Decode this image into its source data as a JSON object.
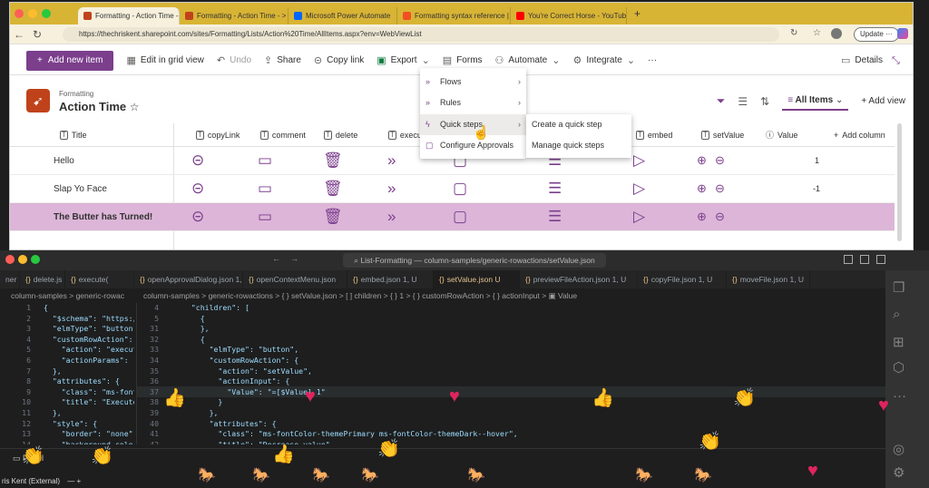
{
  "browser": {
    "tabs": [
      {
        "label": "Formatting - Action Time - All It",
        "color": "#c0421b",
        "active": true
      },
      {
        "label": "Formatting - Action Time - >",
        "color": "#c0421b"
      },
      {
        "label": "Microsoft Power Automate",
        "color": "#0066ff"
      },
      {
        "label": "Formatting syntax reference | N",
        "color": "#f25022"
      },
      {
        "label": "You're Correct Horse - YouTube",
        "color": "#ff0000"
      }
    ],
    "new_tab": "+",
    "url": "https://thechriskent.sharepoint.com/sites/Formatting/Lists/Action%20Time/AllItems.aspx?env=WebViewList",
    "update_label": "Update"
  },
  "commandbar": {
    "new_item": "Add new item",
    "grid_edit": "Edit in grid view",
    "undo": "Undo",
    "share": "Share",
    "copy_link": "Copy link",
    "export": "Export",
    "forms": "Forms",
    "automate": "Automate",
    "integrate": "Integrate",
    "more": "···",
    "details": "Details"
  },
  "list": {
    "site": "Formatting",
    "title": "Action Time",
    "view": "All Items",
    "add_view": "Add view",
    "columns": [
      "Title",
      "copyLink",
      "comment",
      "delete",
      "execut",
      "embed",
      "setValue",
      "Value",
      "Add column"
    ],
    "rows": [
      {
        "title": "Hello",
        "value": "1"
      },
      {
        "title": "Slap Yo Face",
        "value": "-1"
      },
      {
        "title": "The Butter has Turned!",
        "value": ""
      }
    ]
  },
  "automate_menu": {
    "items": [
      "Flows",
      "Rules",
      "Quick steps",
      "Configure Approvals"
    ],
    "submenu": [
      "Create a quick step",
      "Manage quick steps"
    ]
  },
  "vscode": {
    "title": "List-Formatting — column-samples/generic-rowactions/setValue.json",
    "tabs": [
      {
        "label": "ner"
      },
      {
        "label": "delete.js"
      },
      {
        "label": "execute("
      },
      {
        "label": "openApprovalDialog.json 1,"
      },
      {
        "label": "openContextMenu.json"
      },
      {
        "label": "embed.json 1, U"
      },
      {
        "label": "setValue.json U",
        "active": true
      },
      {
        "label": "previewFileAction.json 1, U"
      },
      {
        "label": "copyFile.json 1, U"
      },
      {
        "label": "moveFile.json 1, U"
      }
    ],
    "breadcrumb_left": "column-samples > generic-rowac",
    "breadcrumb_right": "column-samples > generic-rowactions > { } setValue.json > [ ] children > { } 1 > { } customRowAction > { } actionInput > ▣ Value",
    "left_code": [
      {
        "n": "1",
        "t": "{"
      },
      {
        "n": "2",
        "t": "  \"$schema\": \"https:/"
      },
      {
        "n": "3",
        "t": "  \"elmType\": \"button\""
      },
      {
        "n": "4",
        "t": "  \"customRowAction\": {"
      },
      {
        "n": "5",
        "t": "    \"action\": \"execut"
      },
      {
        "n": "6",
        "t": "    \"actionParams\": \""
      },
      {
        "n": "7",
        "t": "  },"
      },
      {
        "n": "8",
        "t": "  \"attributes\": {"
      },
      {
        "n": "9",
        "t": "    \"class\": \"ms-font"
      },
      {
        "n": "10",
        "t": "    \"title\": \"Execute"
      },
      {
        "n": "11",
        "t": "  },"
      },
      {
        "n": "12",
        "t": "  \"style\": {"
      },
      {
        "n": "13",
        "t": "    \"border\": \"none\","
      },
      {
        "n": "14",
        "t": "    \"background-color\""
      }
    ],
    "right_code": [
      {
        "n": "4",
        "t": "  \"children\": ["
      },
      {
        "n": "5",
        "t": "    {"
      },
      {
        "n": "31",
        "t": "    },"
      },
      {
        "n": "32",
        "t": "    {"
      },
      {
        "n": "33",
        "t": "      \"elmType\": \"button\","
      },
      {
        "n": "34",
        "t": "      \"customRowAction\": {"
      },
      {
        "n": "35",
        "t": "        \"action\": \"setValue\","
      },
      {
        "n": "36",
        "t": "        \"actionInput\": {"
      },
      {
        "n": "37",
        "t": "          \"Value\": \"=[$Value] 1\""
      },
      {
        "n": "38",
        "t": "        }"
      },
      {
        "n": "39",
        "t": "      },"
      },
      {
        "n": "40",
        "t": "      \"attributes\": {"
      },
      {
        "n": "41",
        "t": "        \"class\": \"ms-fontColor-themePrimary ms-fontColor-themeDark--hover\","
      },
      {
        "n": "42",
        "t": "        \"title\": \"Decrease value\""
      }
    ],
    "panel_label": "Panel",
    "status": "ris Kent (External)"
  }
}
